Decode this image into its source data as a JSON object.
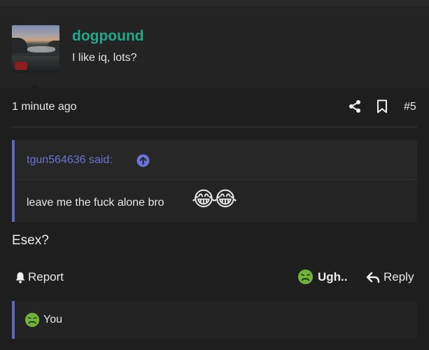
{
  "post": {
    "username": "dogpound",
    "user_title": "I like iq, lots?",
    "time": "1 minute ago",
    "post_number": "#5",
    "body": "Esex?"
  },
  "quote": {
    "author": "tgun564636 said:",
    "text": "leave me the fuck alone bro",
    "emojis": [
      "😂",
      "😂"
    ]
  },
  "actions": {
    "report_label": "Report",
    "reaction_label": "Ugh..",
    "reply_label": "Reply"
  },
  "reactions_bar": {
    "label": "You"
  },
  "icons": {
    "share": "share-icon",
    "bookmark": "bookmark-icon",
    "quote_up": "arrow-up-circle-icon",
    "bell": "bell-icon",
    "ugh": "sick-face-icon",
    "reply": "reply-arrow-icon"
  },
  "colors": {
    "username": "#1fa88e",
    "quote_accent": "#5f65c5",
    "quote_author": "#6b72d6",
    "ugh_green": "#6fb33a"
  }
}
